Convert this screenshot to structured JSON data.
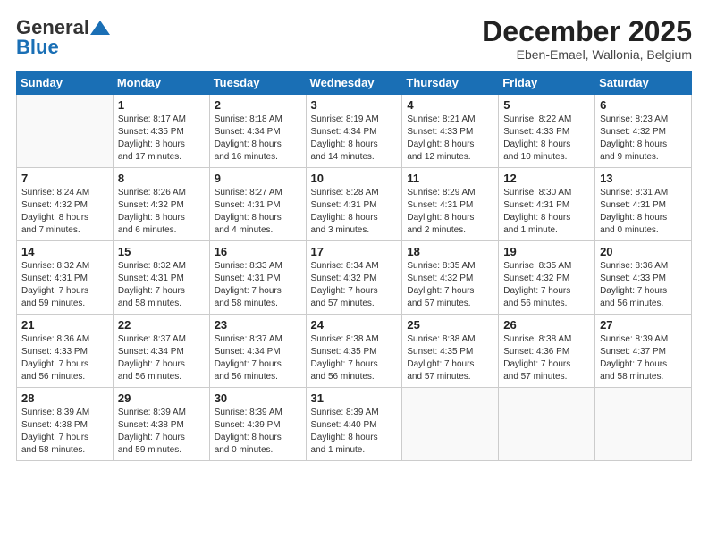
{
  "header": {
    "logo_general": "General",
    "logo_blue": "Blue",
    "month_title": "December 2025",
    "location": "Eben-Emael, Wallonia, Belgium"
  },
  "weekdays": [
    "Sunday",
    "Monday",
    "Tuesday",
    "Wednesday",
    "Thursday",
    "Friday",
    "Saturday"
  ],
  "weeks": [
    [
      {
        "day": "",
        "info": ""
      },
      {
        "day": "1",
        "info": "Sunrise: 8:17 AM\nSunset: 4:35 PM\nDaylight: 8 hours\nand 17 minutes."
      },
      {
        "day": "2",
        "info": "Sunrise: 8:18 AM\nSunset: 4:34 PM\nDaylight: 8 hours\nand 16 minutes."
      },
      {
        "day": "3",
        "info": "Sunrise: 8:19 AM\nSunset: 4:34 PM\nDaylight: 8 hours\nand 14 minutes."
      },
      {
        "day": "4",
        "info": "Sunrise: 8:21 AM\nSunset: 4:33 PM\nDaylight: 8 hours\nand 12 minutes."
      },
      {
        "day": "5",
        "info": "Sunrise: 8:22 AM\nSunset: 4:33 PM\nDaylight: 8 hours\nand 10 minutes."
      },
      {
        "day": "6",
        "info": "Sunrise: 8:23 AM\nSunset: 4:32 PM\nDaylight: 8 hours\nand 9 minutes."
      }
    ],
    [
      {
        "day": "7",
        "info": "Sunrise: 8:24 AM\nSunset: 4:32 PM\nDaylight: 8 hours\nand 7 minutes."
      },
      {
        "day": "8",
        "info": "Sunrise: 8:26 AM\nSunset: 4:32 PM\nDaylight: 8 hours\nand 6 minutes."
      },
      {
        "day": "9",
        "info": "Sunrise: 8:27 AM\nSunset: 4:31 PM\nDaylight: 8 hours\nand 4 minutes."
      },
      {
        "day": "10",
        "info": "Sunrise: 8:28 AM\nSunset: 4:31 PM\nDaylight: 8 hours\nand 3 minutes."
      },
      {
        "day": "11",
        "info": "Sunrise: 8:29 AM\nSunset: 4:31 PM\nDaylight: 8 hours\nand 2 minutes."
      },
      {
        "day": "12",
        "info": "Sunrise: 8:30 AM\nSunset: 4:31 PM\nDaylight: 8 hours\nand 1 minute."
      },
      {
        "day": "13",
        "info": "Sunrise: 8:31 AM\nSunset: 4:31 PM\nDaylight: 8 hours\nand 0 minutes."
      }
    ],
    [
      {
        "day": "14",
        "info": "Sunrise: 8:32 AM\nSunset: 4:31 PM\nDaylight: 7 hours\nand 59 minutes."
      },
      {
        "day": "15",
        "info": "Sunrise: 8:32 AM\nSunset: 4:31 PM\nDaylight: 7 hours\nand 58 minutes."
      },
      {
        "day": "16",
        "info": "Sunrise: 8:33 AM\nSunset: 4:31 PM\nDaylight: 7 hours\nand 58 minutes."
      },
      {
        "day": "17",
        "info": "Sunrise: 8:34 AM\nSunset: 4:32 PM\nDaylight: 7 hours\nand 57 minutes."
      },
      {
        "day": "18",
        "info": "Sunrise: 8:35 AM\nSunset: 4:32 PM\nDaylight: 7 hours\nand 57 minutes."
      },
      {
        "day": "19",
        "info": "Sunrise: 8:35 AM\nSunset: 4:32 PM\nDaylight: 7 hours\nand 56 minutes."
      },
      {
        "day": "20",
        "info": "Sunrise: 8:36 AM\nSunset: 4:33 PM\nDaylight: 7 hours\nand 56 minutes."
      }
    ],
    [
      {
        "day": "21",
        "info": "Sunrise: 8:36 AM\nSunset: 4:33 PM\nDaylight: 7 hours\nand 56 minutes."
      },
      {
        "day": "22",
        "info": "Sunrise: 8:37 AM\nSunset: 4:34 PM\nDaylight: 7 hours\nand 56 minutes."
      },
      {
        "day": "23",
        "info": "Sunrise: 8:37 AM\nSunset: 4:34 PM\nDaylight: 7 hours\nand 56 minutes."
      },
      {
        "day": "24",
        "info": "Sunrise: 8:38 AM\nSunset: 4:35 PM\nDaylight: 7 hours\nand 56 minutes."
      },
      {
        "day": "25",
        "info": "Sunrise: 8:38 AM\nSunset: 4:35 PM\nDaylight: 7 hours\nand 57 minutes."
      },
      {
        "day": "26",
        "info": "Sunrise: 8:38 AM\nSunset: 4:36 PM\nDaylight: 7 hours\nand 57 minutes."
      },
      {
        "day": "27",
        "info": "Sunrise: 8:39 AM\nSunset: 4:37 PM\nDaylight: 7 hours\nand 58 minutes."
      }
    ],
    [
      {
        "day": "28",
        "info": "Sunrise: 8:39 AM\nSunset: 4:38 PM\nDaylight: 7 hours\nand 58 minutes."
      },
      {
        "day": "29",
        "info": "Sunrise: 8:39 AM\nSunset: 4:38 PM\nDaylight: 7 hours\nand 59 minutes."
      },
      {
        "day": "30",
        "info": "Sunrise: 8:39 AM\nSunset: 4:39 PM\nDaylight: 8 hours\nand 0 minutes."
      },
      {
        "day": "31",
        "info": "Sunrise: 8:39 AM\nSunset: 4:40 PM\nDaylight: 8 hours\nand 1 minute."
      },
      {
        "day": "",
        "info": ""
      },
      {
        "day": "",
        "info": ""
      },
      {
        "day": "",
        "info": ""
      }
    ]
  ]
}
